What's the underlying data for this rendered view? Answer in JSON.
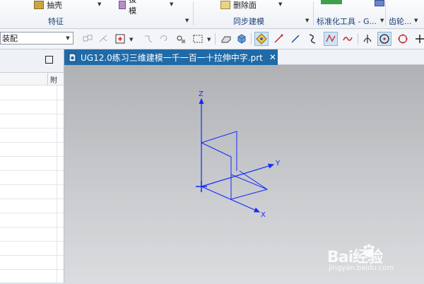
{
  "ribbon": {
    "groups": [
      {
        "label": "特征",
        "buttons": [
          {
            "label": "抽壳"
          },
          {
            "label": "拔模"
          }
        ]
      },
      {
        "label": "同步建模",
        "buttons": [
          {
            "label": "删除面"
          }
        ]
      },
      {
        "label": "标准化工具 - G...",
        "buttons": []
      },
      {
        "label": "齿轮...",
        "buttons": []
      }
    ]
  },
  "toolbar": {
    "assembly_combo": "装配"
  },
  "navigator": {
    "header_col2": "附",
    "row_count": 14
  },
  "tab": {
    "title": "UG12.0练习三维建模一千一百一十拉伸中字.prt",
    "close": "✕"
  },
  "scene": {
    "axis_color": "#1428ff",
    "axes": {
      "z": "Z",
      "y": "Y",
      "x": "X"
    }
  },
  "watermark": {
    "brand": "Bai经验",
    "url": "jingyan.baidu.com"
  }
}
